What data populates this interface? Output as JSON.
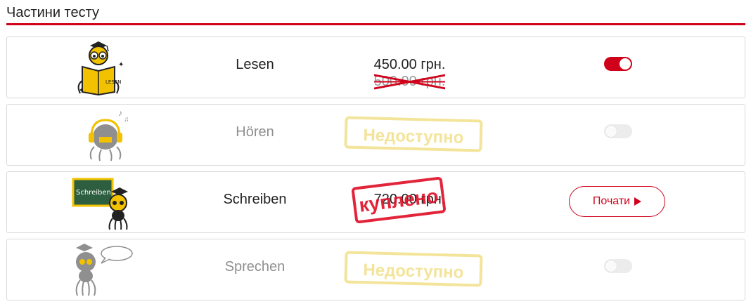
{
  "header": {
    "title": "Частини тесту"
  },
  "colors": {
    "accent": "#d0021b",
    "stamp_unavailable": "#f3e49a",
    "stamp_bought": "#e0132b"
  },
  "parts": [
    {
      "name": "Lesen",
      "price_current": "450.00 грн.",
      "price_old": "500.00 грн.",
      "toggle_on": true,
      "mascot_icon": "reading-spider-icon"
    },
    {
      "name": "Hören",
      "stamp": "Недоступно",
      "toggle_on": false,
      "mascot_icon": "listening-spider-icon"
    },
    {
      "name": "Schreiben",
      "price_current": "720.00 грн.",
      "stamp": "куплено",
      "button_label": "Почати",
      "mascot_icon": "writing-spider-icon",
      "board_text": "Schreiben"
    },
    {
      "name": "Sprechen",
      "stamp": "Недоступно",
      "toggle_on": false,
      "mascot_icon": "speaking-spider-icon"
    }
  ]
}
